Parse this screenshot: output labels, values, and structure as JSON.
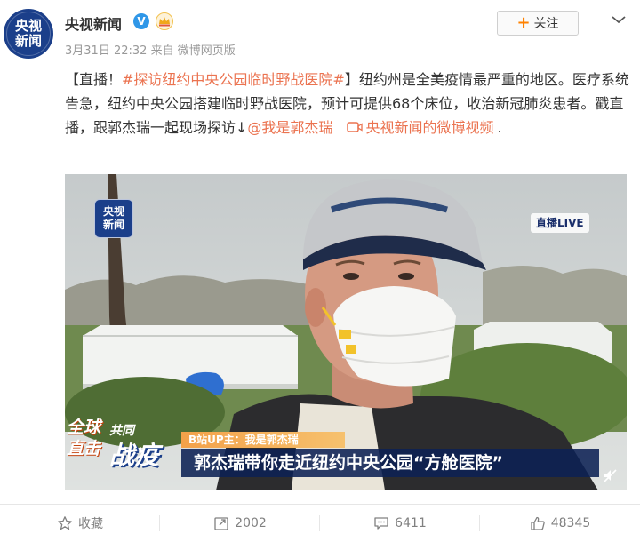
{
  "post": {
    "author": "央视新闻",
    "avatar_lines": [
      "央视",
      "新闻"
    ],
    "verified_mark": "V",
    "timestamp": "3月31日 22:32",
    "source": "来自 微博网页版",
    "follow_plus": "+",
    "follow_label": "关注",
    "text": {
      "bracket_tag": "【直播！",
      "hashtag": "#探访纽约中央公园临时野战医院#",
      "body": "】纽约州是全美疫情最严重的地区。医疗系统告急，纽约中央公园搭建临时野战医院，预计可提供68个床位，收治新冠肺炎患者。戳直播，跟郭杰瑞一起现场探访↓",
      "mention": "@我是郭杰瑞",
      "video_link": "央视新闻的微博视频",
      "end": "."
    }
  },
  "video": {
    "logo_lines": [
      "央视",
      "新闻"
    ],
    "live_badge": "直播LIVE",
    "brand_top": [
      "全球",
      "直击"
    ],
    "brand_small": "共同",
    "brand_big": "战疫",
    "uploader": "B站UP主：我是郭杰瑞",
    "caption": "郭杰瑞带你走近纽约中央公园“方舱医院”"
  },
  "actions": {
    "favorite_label": "收藏",
    "repost_count": "2002",
    "comment_count": "6411",
    "like_count": "48345"
  },
  "colors": {
    "link": "#eb7350",
    "brand_blue": "#1b3f8a",
    "follow_plus": "#ff8200",
    "verified": "#2f97e8"
  },
  "icons": [
    "star-icon",
    "repost-icon",
    "comment-icon",
    "thumbs-up-icon",
    "chevron-down-icon",
    "link-video-icon",
    "mute-icon",
    "crown-icon"
  ]
}
